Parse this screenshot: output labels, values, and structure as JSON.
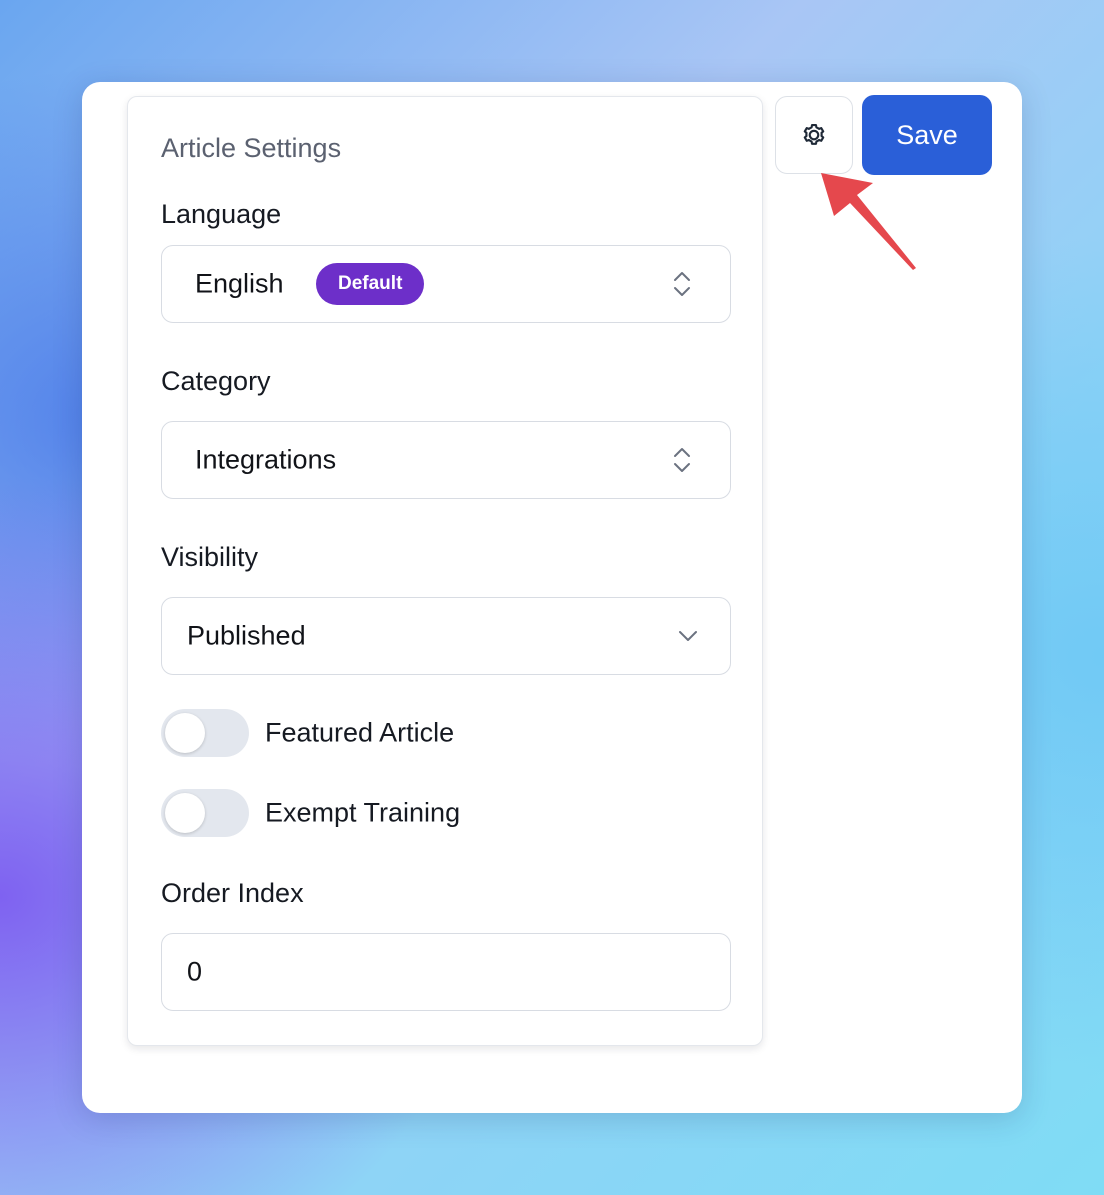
{
  "panel": {
    "title": "Article Settings"
  },
  "language": {
    "label": "Language",
    "value": "English",
    "badge": "Default",
    "badge_color": "#6d2fc9"
  },
  "category": {
    "label": "Category",
    "value": "Integrations"
  },
  "visibility": {
    "label": "Visibility",
    "value": "Published"
  },
  "toggles": [
    {
      "label": "Featured Article",
      "on": false
    },
    {
      "label": "Exempt Training",
      "on": false
    }
  ],
  "order_index": {
    "label": "Order Index",
    "value": "0"
  },
  "toolbar": {
    "settings_icon": "gear-icon",
    "save_label": "Save",
    "save_color": "#2a5fd8"
  },
  "annotation": {
    "arrow_icon": "arrow-icon",
    "arrow_color": "#e5484d"
  }
}
